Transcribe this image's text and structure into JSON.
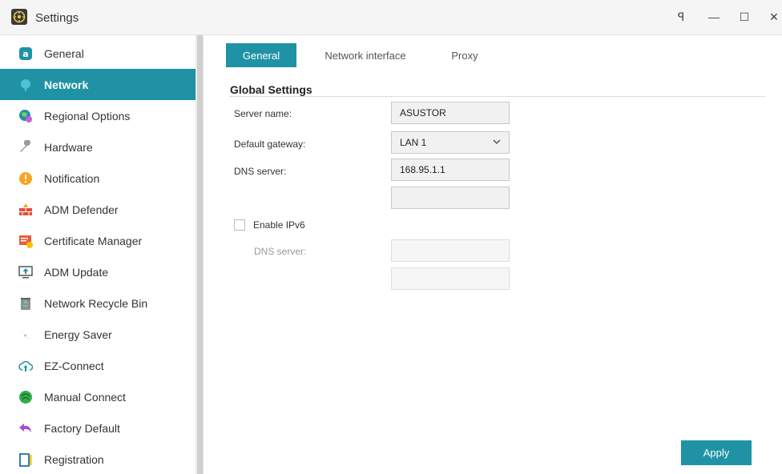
{
  "window": {
    "title": "Settings",
    "controls": {
      "pin": "ꟼ",
      "minimize": "—",
      "maximize": "☐",
      "close": "✕"
    }
  },
  "sidebar": {
    "items": [
      {
        "label": "General",
        "icon": "general-icon"
      },
      {
        "label": "Network",
        "icon": "network-icon",
        "active": true
      },
      {
        "label": "Regional Options",
        "icon": "globe-icon"
      },
      {
        "label": "Hardware",
        "icon": "wrench-icon"
      },
      {
        "label": "Notification",
        "icon": "alert-icon"
      },
      {
        "label": "ADM Defender",
        "icon": "firewall-icon"
      },
      {
        "label": "Certificate Manager",
        "icon": "certificate-icon"
      },
      {
        "label": "ADM Update",
        "icon": "update-icon"
      },
      {
        "label": "Network Recycle Bin",
        "icon": "recycle-bin-icon"
      },
      {
        "label": "Energy Saver",
        "icon": "lightning-icon"
      },
      {
        "label": "EZ-Connect",
        "icon": "cloud-upload-icon"
      },
      {
        "label": "Manual Connect",
        "icon": "connect-icon"
      },
      {
        "label": "Factory Default",
        "icon": "undo-icon"
      },
      {
        "label": "Registration",
        "icon": "registration-icon"
      }
    ]
  },
  "tabs": [
    "General",
    "Network interface",
    "Proxy"
  ],
  "section": {
    "title": "Global Settings"
  },
  "form": {
    "server_name_label": "Server name:",
    "server_name_value": "ASUSTOR",
    "gateway_label": "Default gateway:",
    "gateway_value": "LAN 1",
    "dns_label": "DNS server:",
    "dns_value_1": "168.95.1.1",
    "dns_value_2": "",
    "ipv6_label": "Enable IPv6",
    "ipv6_checked": false,
    "ipv6_dns_label": "DNS server:",
    "ipv6_dns_value_1": "",
    "ipv6_dns_value_2": ""
  },
  "apply_label": "Apply",
  "colors": {
    "accent": "#1f93a5"
  }
}
